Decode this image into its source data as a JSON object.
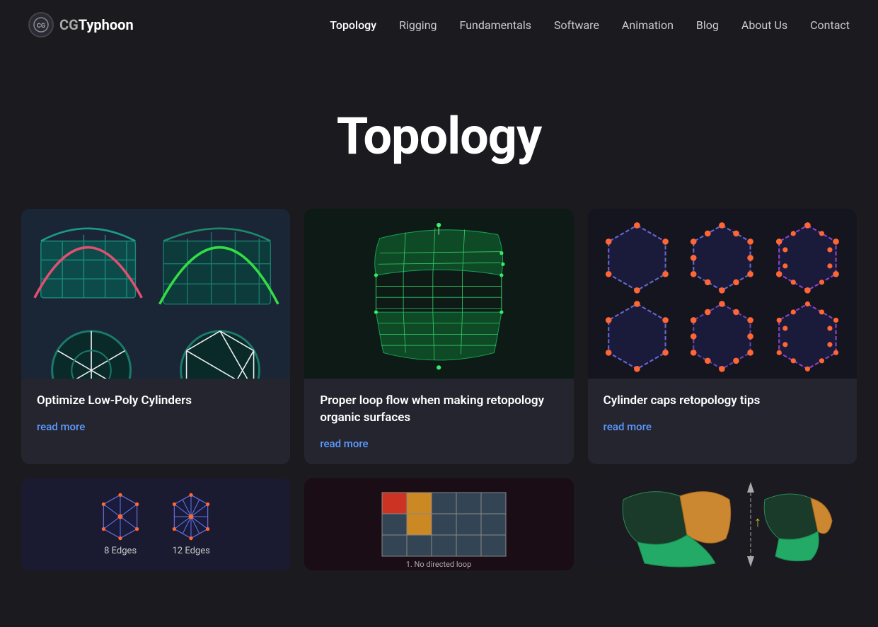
{
  "site": {
    "logo_cg": "CG",
    "logo_name": "Typhoon"
  },
  "nav": {
    "items": [
      {
        "label": "Topology",
        "active": true
      },
      {
        "label": "Rigging",
        "active": false
      },
      {
        "label": "Fundamentals",
        "active": false
      },
      {
        "label": "Software",
        "active": false
      },
      {
        "label": "Animation",
        "active": false
      },
      {
        "label": "Blog",
        "active": false
      },
      {
        "label": "About Us",
        "active": false
      },
      {
        "label": "Contact",
        "active": false
      }
    ]
  },
  "hero": {
    "title": "Topology"
  },
  "cards": [
    {
      "id": "cylinders",
      "title": "Optimize Low-Poly Cylinders",
      "link_text": "read more"
    },
    {
      "id": "loop-flow",
      "title": "Proper loop flow when making retopology organic surfaces",
      "link_text": "read more"
    },
    {
      "id": "cylinder-caps",
      "title": "Cylinder caps retopology tips",
      "link_text": "read more"
    }
  ],
  "partial_cards": [
    {
      "id": "edges",
      "label1": "8 Edges",
      "label2": "12 Edges"
    },
    {
      "id": "no-loop",
      "label": "1. No directed loop"
    },
    {
      "id": "organic",
      "label": ""
    }
  ],
  "colors": {
    "accent_blue": "#5b9aff",
    "bg_dark": "#1a1a1f",
    "bg_card": "#252530",
    "green": "#2ecc71",
    "teal": "#008080"
  }
}
